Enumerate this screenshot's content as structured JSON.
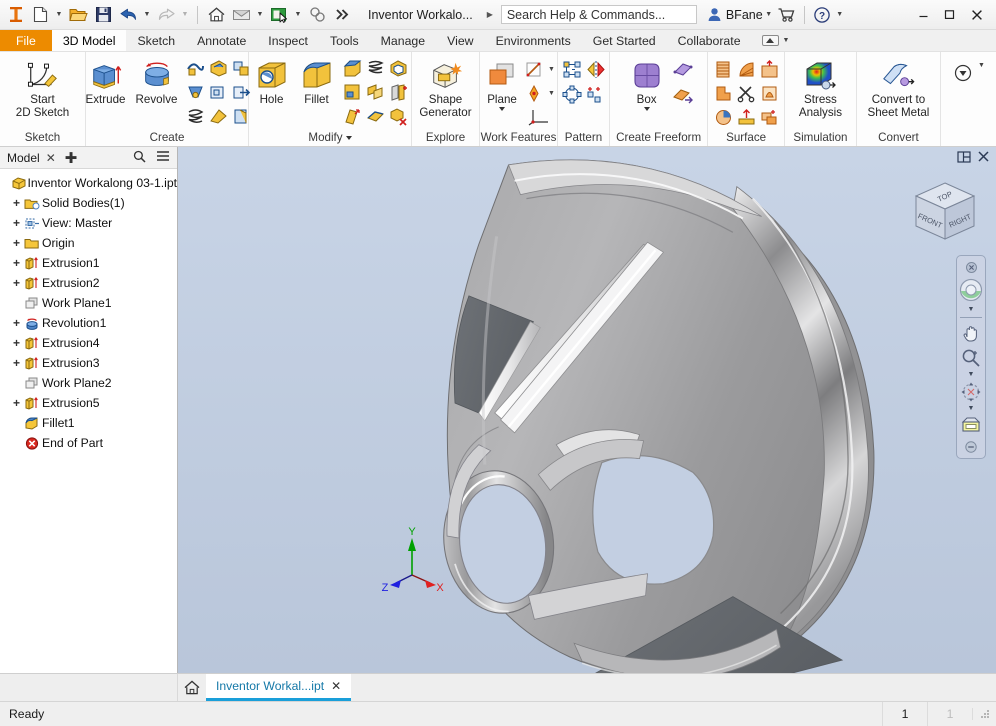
{
  "titlebar": {
    "app_icon": "inventor-logo-icon",
    "quick_access": [
      {
        "name": "new-file-button",
        "icon": "new-file-icon"
      },
      {
        "name": "new-file-dropdown",
        "icon": "chevron-down-icon"
      },
      {
        "name": "open-file-button",
        "icon": "open-folder-icon"
      },
      {
        "name": "save-button",
        "icon": "save-disk-icon"
      },
      {
        "name": "undo-button",
        "icon": "undo-arrow-icon"
      },
      {
        "name": "undo-dropdown",
        "icon": "chevron-down-icon"
      },
      {
        "name": "redo-button",
        "icon": "redo-arrow-icon"
      },
      {
        "name": "redo-dropdown",
        "icon": "chevron-down-icon"
      },
      {
        "name": "home-button",
        "icon": "home-icon"
      },
      {
        "name": "return-button",
        "icon": "return-icon"
      },
      {
        "name": "return-dropdown",
        "icon": "chevron-down-icon"
      },
      {
        "name": "update-button",
        "icon": "green-book-cursor-icon"
      },
      {
        "name": "update-dropdown",
        "icon": "chevron-down-icon"
      },
      {
        "name": "select-button",
        "icon": "select-filter-icon"
      },
      {
        "name": "qat-overflow-button",
        "icon": "double-chevron-right-icon"
      }
    ],
    "document_title": "Inventor Workalo...",
    "search_placeholder": "Search Help & Commands...",
    "search_value": "",
    "user_name": "BFane",
    "user_dropdown_icon": "chevron-down-icon",
    "cart_icon": "shopping-cart-icon",
    "help_icon": "help-question-icon",
    "help_dropdown_icon": "chevron-down-icon",
    "minimize_label": "–",
    "maximize_label": "☐",
    "close_label": "✕"
  },
  "ribbon_tabs": {
    "file_label": "File",
    "tabs": [
      {
        "label": "3D Model",
        "active": true
      },
      {
        "label": "Sketch",
        "active": false
      },
      {
        "label": "Annotate",
        "active": false
      },
      {
        "label": "Inspect",
        "active": false
      },
      {
        "label": "Tools",
        "active": false
      },
      {
        "label": "Manage",
        "active": false
      },
      {
        "label": "View",
        "active": false
      },
      {
        "label": "Environments",
        "active": false
      },
      {
        "label": "Get Started",
        "active": false
      },
      {
        "label": "Collaborate",
        "active": false
      }
    ],
    "minimize_ribbon_icon": "ribbon-minimize-icon",
    "minimize_ribbon_caret": "chevron-down-icon"
  },
  "ribbon_panels": [
    {
      "title": "Sketch",
      "has_dialog_launcher": true,
      "big_buttons": [
        {
          "label_line1": "Start",
          "label_line2": "2D Sketch",
          "icon": "start-2d-sketch-icon",
          "has_caret": true
        }
      ],
      "small_icons": []
    },
    {
      "title": "Create",
      "big_buttons": [
        {
          "label_line1": "Extrude",
          "label_line2": "",
          "icon": "extrude-icon"
        },
        {
          "label_line1": "Revolve",
          "label_line2": "",
          "icon": "revolve-icon"
        }
      ],
      "small_icons": [
        "sweep-icon",
        "emboss-icon",
        "derive-icon",
        "loft-icon",
        "rib-icon",
        "import-icon",
        "coil-icon",
        "decal-icon",
        "unwrap-icon"
      ]
    },
    {
      "title": "Modify",
      "has_caret": true,
      "big_buttons": [
        {
          "label_line1": "Hole",
          "label_line2": "",
          "icon": "hole-icon"
        },
        {
          "label_line1": "Fillet",
          "label_line2": "",
          "icon": "fillet-icon"
        }
      ],
      "small_icons": [
        "chamfer-icon",
        "thread-icon",
        "shell-icon",
        "draft-icon",
        "combine-icon",
        "split-icon",
        "direct-edit-icon",
        "thicken-offset-icon",
        "delete-face-icon"
      ]
    },
    {
      "title": "Explore",
      "big_buttons": [
        {
          "label_line1": "Shape",
          "label_line2": "Generator",
          "icon": "shape-generator-icon"
        }
      ],
      "small_icons": []
    },
    {
      "title": "Work Features",
      "big_buttons": [
        {
          "label_line1": "Plane",
          "label_line2": "",
          "icon": "work-plane-icon",
          "has_caret": true
        }
      ],
      "small_icons": [
        "work-axis-icon",
        "work-point-icon",
        "ucs-icon"
      ]
    },
    {
      "title": "Pattern",
      "big_buttons": [],
      "small_icons": [
        "rectangular-pattern-icon",
        "mirror-icon",
        "circular-pattern-icon",
        "sketch-driven-pattern-icon"
      ]
    },
    {
      "title": "Create Freeform",
      "big_buttons": [
        {
          "label_line1": "Box",
          "label_line2": "",
          "icon": "freeform-box-icon",
          "has_caret": true
        }
      ],
      "small_icons": [
        "freeform-plane-icon",
        "freeform-convert-icon"
      ]
    },
    {
      "title": "Surface",
      "big_buttons": [],
      "small_icons": [
        "ruled-surface-icon",
        "patch-icon",
        "stitch-icon",
        "extend-icon",
        "trim-icon",
        "sculpt-icon",
        "replace-face-icon",
        "boundary-patch-icon",
        "copy-surface-icon"
      ]
    },
    {
      "title": "Simulation",
      "big_buttons": [
        {
          "label_line1": "Stress",
          "label_line2": "Analysis",
          "icon": "stress-analysis-icon"
        }
      ],
      "small_icons": []
    },
    {
      "title": "Convert",
      "big_buttons": [
        {
          "label_line1": "Convert to",
          "label_line2": "Sheet Metal",
          "icon": "convert-sheet-metal-icon"
        }
      ],
      "small_icons": []
    },
    {
      "title": "",
      "big_buttons": [],
      "small_icons": [
        "panel-overflow-icon"
      ],
      "overflow_caret": true
    }
  ],
  "browser": {
    "tab_label": "Model",
    "close_icon": "close-icon",
    "add_tab_icon": "plus-icon",
    "search_icon": "search-icon",
    "menu_icon": "hamburger-menu-icon",
    "tree": [
      {
        "label": "Inventor Workalong 03-1.ipt",
        "icon": "part-document-icon",
        "expander": "none",
        "level": 0
      },
      {
        "label": "Solid Bodies(1)",
        "icon": "solid-bodies-folder-icon",
        "expander": "plus",
        "level": 1
      },
      {
        "label": "View: Master",
        "icon": "view-master-icon",
        "expander": "plus",
        "level": 1
      },
      {
        "label": "Origin",
        "icon": "origin-folder-icon",
        "expander": "plus",
        "level": 1
      },
      {
        "label": "Extrusion1",
        "icon": "extrusion-icon",
        "expander": "plus",
        "level": 1
      },
      {
        "label": "Extrusion2",
        "icon": "extrusion-icon",
        "expander": "plus",
        "level": 1
      },
      {
        "label": "Work Plane1",
        "icon": "work-plane-icon",
        "expander": "none",
        "level": 1
      },
      {
        "label": "Revolution1",
        "icon": "revolution-icon",
        "expander": "plus",
        "level": 1
      },
      {
        "label": "Extrusion4",
        "icon": "extrusion-icon",
        "expander": "plus",
        "level": 1
      },
      {
        "label": "Extrusion3",
        "icon": "extrusion-icon",
        "expander": "plus",
        "level": 1
      },
      {
        "label": "Work Plane2",
        "icon": "work-plane-icon",
        "expander": "none",
        "level": 1
      },
      {
        "label": "Extrusion5",
        "icon": "extrusion-icon",
        "expander": "plus",
        "level": 1
      },
      {
        "label": "Fillet1",
        "icon": "fillet-icon",
        "expander": "none",
        "level": 1
      },
      {
        "label": "End of Part",
        "icon": "end-of-part-icon",
        "expander": "none",
        "level": 1
      }
    ]
  },
  "viewport": {
    "panel_tile_icon": "tile-windows-icon",
    "panel_close_icon": "close-icon",
    "viewcube": {
      "top_face": "TOP",
      "front_face": "FRONT",
      "right_face": "RIGHT"
    },
    "navbar": [
      {
        "name": "navbar-close-button",
        "icon": "close-small-icon"
      },
      {
        "name": "steeringwheel-button",
        "icon": "steering-wheel-icon"
      },
      {
        "name": "steeringwheel-dropdown",
        "icon": "chevron-down-icon"
      },
      {
        "name": "pan-button",
        "icon": "pan-hand-icon"
      },
      {
        "name": "zoom-button",
        "icon": "zoom-magnifier-icon"
      },
      {
        "name": "zoom-dropdown",
        "icon": "chevron-down-icon"
      },
      {
        "name": "orbit-button",
        "icon": "orbit-icon"
      },
      {
        "name": "orbit-dropdown",
        "icon": "chevron-down-icon"
      },
      {
        "name": "look-at-button",
        "icon": "look-at-icon"
      },
      {
        "name": "navbar-options-button",
        "icon": "navbar-options-icon"
      }
    ],
    "axis_labels": {
      "x": "X",
      "y": "Y",
      "z": "Z"
    },
    "axis_colors": {
      "x": "#e02020",
      "y": "#00a000",
      "z": "#2020e0"
    },
    "background_top": "#c8d4e6",
    "background_bottom": "#b9c6da",
    "model_name": "cone-bracket-part"
  },
  "doc_tabs": {
    "home_icon": "home-icon",
    "tabs": [
      {
        "label": "Inventor Workal...ipt",
        "close_icon": "close-icon",
        "active": true
      }
    ],
    "accent_color": "#1a9fd9"
  },
  "status_bar": {
    "message": "Ready",
    "cell1": "1",
    "cell2": "1",
    "grip_icon": "resize-grip-icon"
  }
}
